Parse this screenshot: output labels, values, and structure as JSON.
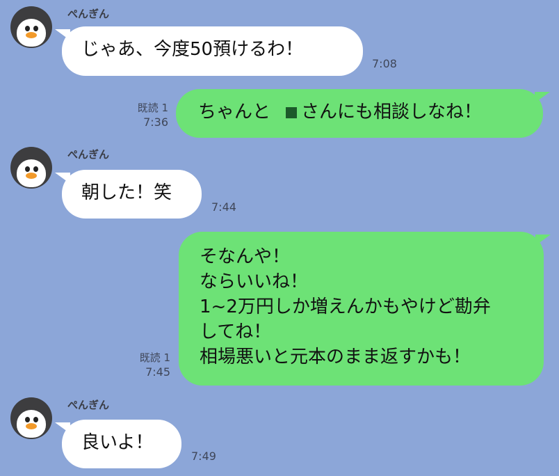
{
  "messages": [
    {
      "sender": "ぺんぎん",
      "text": "じゃあ、今度50預けるわ！",
      "time": "7:08"
    },
    {
      "read": "既読 1",
      "time": "7:36",
      "text_before": "ちゃんと",
      "text_after": "さんにも相談しなね！"
    },
    {
      "sender": "ぺんぎん",
      "text": "朝した！笑",
      "time": "7:44"
    },
    {
      "read": "既読 1",
      "time": "7:45",
      "lines": [
        "そなんや！",
        "ならいいね！",
        "1~2万円しか増えんかもやけど勘弁",
        "してね！",
        "相場悪いと元本のまま返すかも！"
      ]
    },
    {
      "sender": "ぺんぎん",
      "text": "良いよ！",
      "time": "7:49"
    }
  ],
  "colors": {
    "background": "#8ca6d8",
    "incoming": "#ffffff",
    "outgoing": "#6de276"
  },
  "icons": {
    "avatar": "penguin-icon"
  }
}
